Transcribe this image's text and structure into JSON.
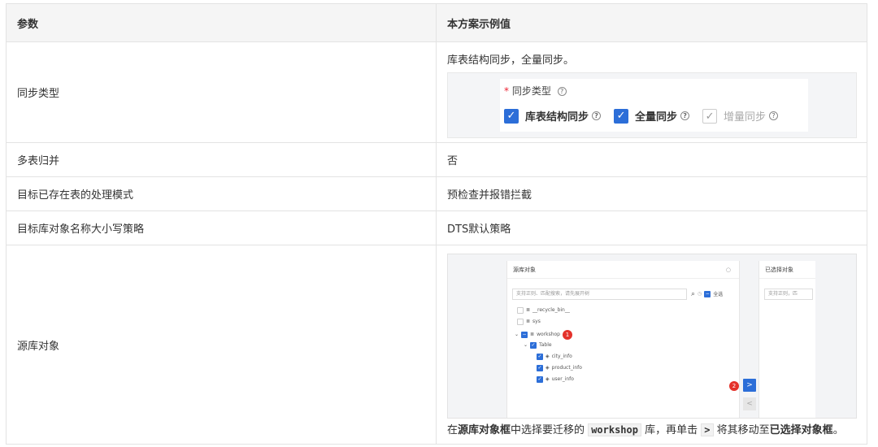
{
  "header": {
    "col1": "参数",
    "col2": "本方案示例值"
  },
  "rows": [
    {
      "param": "同步类型",
      "value": "库表结构同步，全量同步。"
    },
    {
      "param": "多表归并",
      "value": "否"
    },
    {
      "param": "目标已存在表的处理模式",
      "value": "预检查并报错拦截"
    },
    {
      "param": "目标库对象名称大小写策略",
      "value": "DTS默认策略"
    },
    {
      "param": "源库对象",
      "value": ""
    }
  ],
  "sync_widget": {
    "star": "*",
    "label": "同步类型",
    "help": "?",
    "options": [
      {
        "label": "库表结构同步",
        "checked": true
      },
      {
        "label": "全量同步",
        "checked": true
      },
      {
        "label": "增量同步",
        "checked": true,
        "disabled": true
      }
    ]
  },
  "source_shot": {
    "left_title": "源库对象",
    "right_title": "已选择对象",
    "search_placeholder": "支持正则、匹配搜索，请先展开树",
    "right_search": "支持正则，匹",
    "select_all": "全选",
    "tree": [
      "__recycle_bin__",
      "sys",
      "workshop",
      "Table",
      "city_info",
      "product_info",
      "user_info"
    ],
    "badge1": "1",
    "badge2": "2",
    "arrow": ">",
    "arrow_back": "<"
  },
  "caption": {
    "p1": "在",
    "b1": "源库对象框",
    "p2": "中选择要迁移的",
    "code1": "workshop",
    "p3": "库，再单击",
    "code2": ">",
    "p4": "将其移动至",
    "b2": "已选择对象框",
    "p5": "。"
  }
}
